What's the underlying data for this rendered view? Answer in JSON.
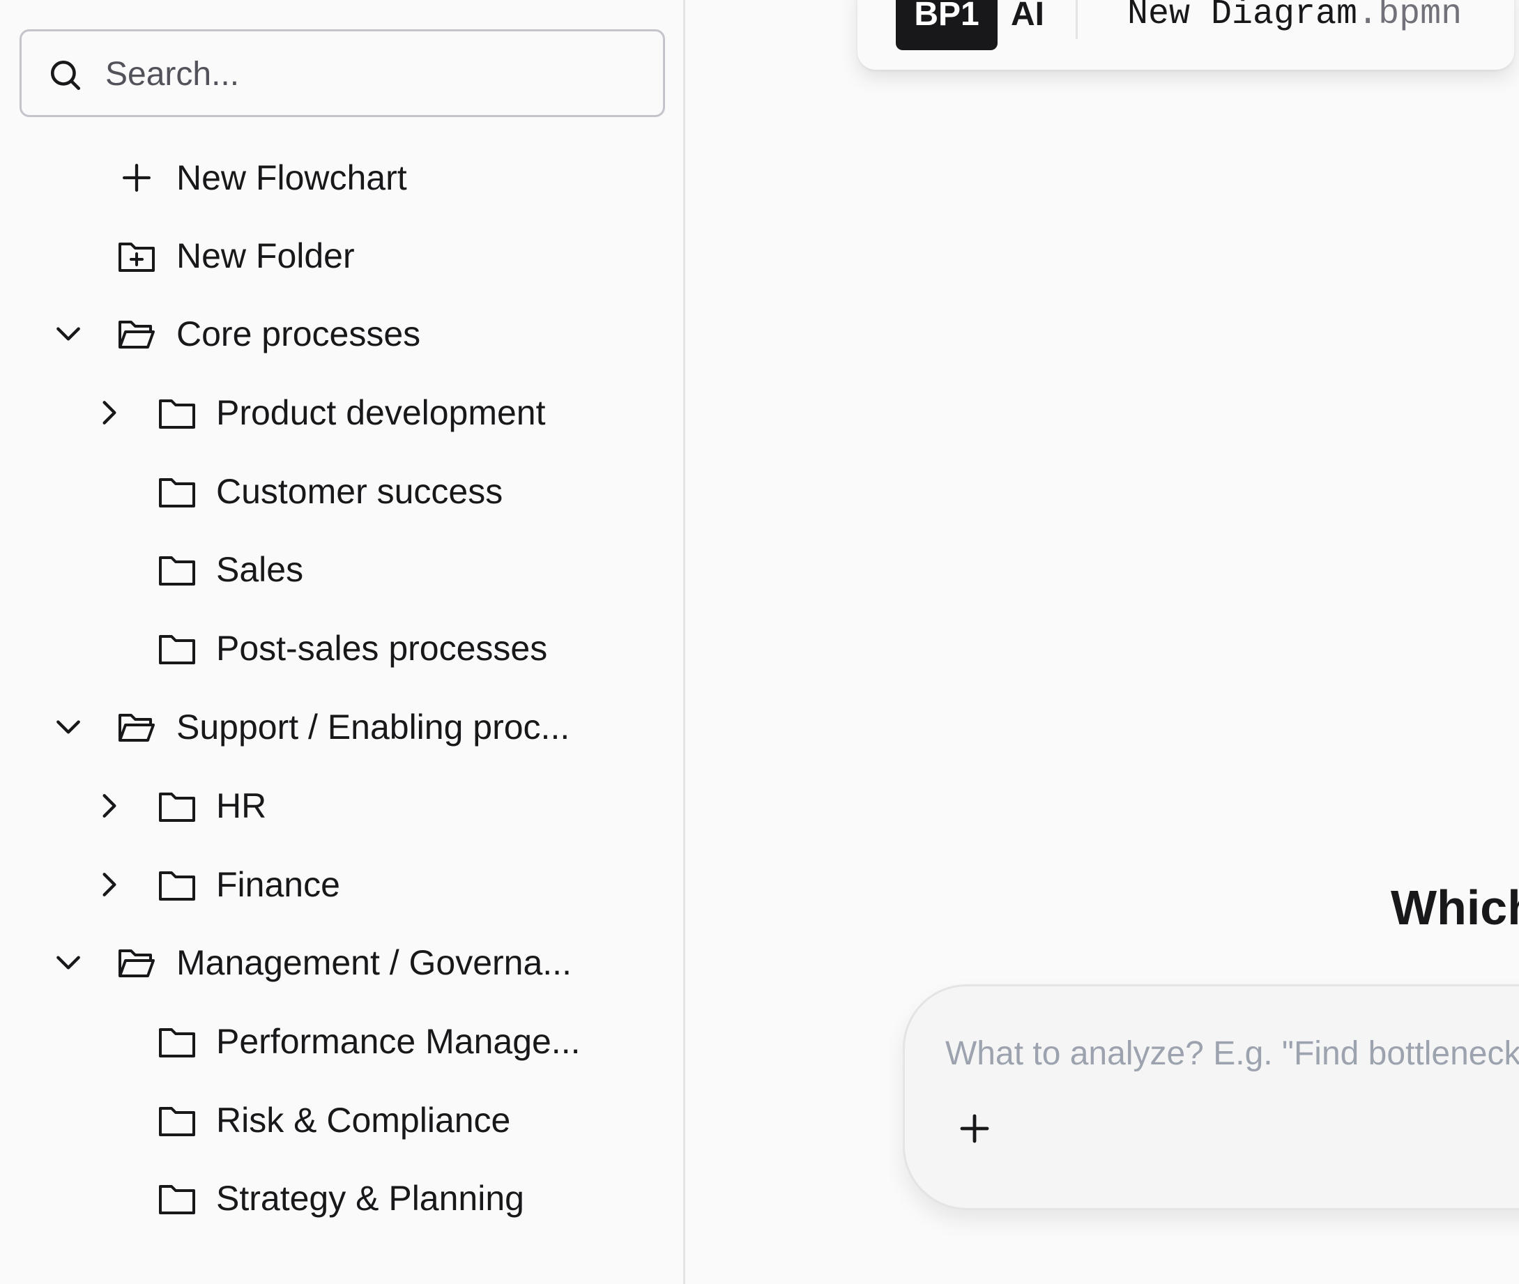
{
  "sidebar": {
    "search": {
      "placeholder": "Search..."
    },
    "actions": {
      "new_flowchart": "New Flowchart",
      "new_folder": "New Folder"
    },
    "tree": {
      "core": {
        "label": "Core processes",
        "children": [
          "Product development",
          "Customer success",
          "Sales",
          "Post-sales processes"
        ]
      },
      "support": {
        "label": "Support / Enabling proc...",
        "children": [
          "HR",
          "Finance"
        ]
      },
      "management": {
        "label": "Management / Governa...",
        "children": [
          "Performance Manage...",
          "Risk & Compliance",
          "Strategy & Planning"
        ]
      }
    }
  },
  "topbar": {
    "badge": "BP1",
    "ai_label": "AI",
    "filename": "New Diagram",
    "extension": ".bpmn"
  },
  "main": {
    "heading": "Which",
    "prompt_placeholder": "What to analyze? E.g. \"Find bottleneck"
  },
  "colors": {
    "background": "#fafafa",
    "text": "#18181b",
    "border": "#c4c4cc",
    "badge_bg": "#18181b",
    "placeholder": "#9ca3af"
  },
  "icons": {
    "search": "search-icon",
    "plus": "plus-icon",
    "folder_plus": "folder-plus-icon",
    "folder_open": "folder-open-icon",
    "folder": "folder-icon",
    "chevron_down": "chevron-down-icon",
    "chevron_right": "chevron-right-icon"
  }
}
